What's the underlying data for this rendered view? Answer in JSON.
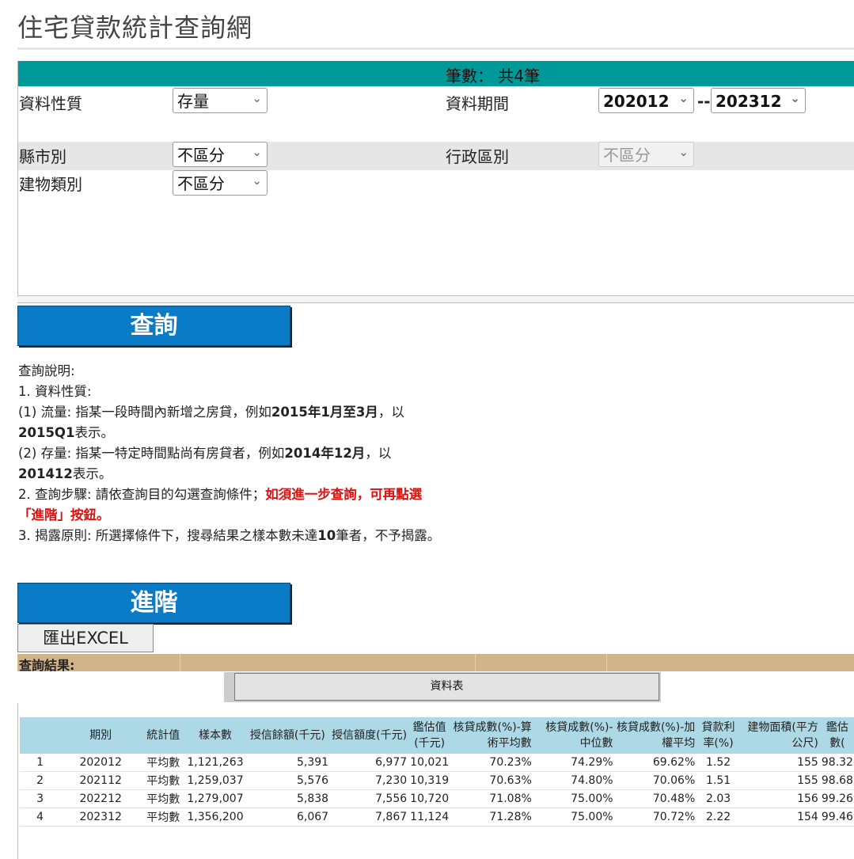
{
  "page_title": "住宅貸款統計查詢網",
  "record_count": "筆數： 共4筆",
  "filters": {
    "data_type_label": "資料性質",
    "data_type_value": "存量",
    "period_label": "資料期間",
    "period_from": "202012",
    "period_to": "202312",
    "period_sep": "--",
    "county_label": "縣市別",
    "county_value": "不區分",
    "district_label": "行政區別",
    "district_value": "不區分",
    "building_label": "建物類別",
    "building_value": "不區分"
  },
  "buttons": {
    "query": "查詢",
    "advanced": "進階",
    "export": "匯出EXCEL",
    "data_table": "資料表"
  },
  "help": {
    "heading": "查詢說明:",
    "item1": "1. 資料性質:",
    "flow_a": "(1) 流量: 指某一段時間內新增之房貸，例如",
    "flow_b": "2015年1月至3月",
    "flow_c": "，以",
    "flow_d": "2015Q1",
    "flow_e": "表示。",
    "stock_a": "(2) 存量: 指某一特定時間點尚有房貸者，例如",
    "stock_b": "2014年12月",
    "stock_c": "，以",
    "stock_d": "201412",
    "stock_e": "表示。",
    "item2a": "2. 查詢步驟: 請依查詢目的勾選查詢條件；",
    "item2b": "如須進一步查詢，可再點選「進階」按鈕。",
    "item3a": "3. 揭露原則: 所選擇條件下，搜尋結果之樣本數未達",
    "item3b": "10",
    "item3c": "筆者，不予揭露。"
  },
  "results_label": "查詢結果:",
  "table": {
    "headers": [
      "",
      "期別",
      "統計值",
      "樣本數",
      "授信餘額(千元)",
      "授信額度(千元)",
      "鑑估值(千元)",
      "核貸成數(%)-算術平均數",
      "核貸成數(%)-中位數",
      "核貸成數(%)-加權平均",
      "貸款利率(%)",
      "建物面積(平方公尺)",
      "鑑估數("
    ],
    "rows": [
      [
        "1",
        "202012",
        "平均數",
        "1,121,263",
        "5,391",
        "6,977",
        "10,021",
        "70.23%",
        "74.29%",
        "69.62%",
        "1.52",
        "155",
        "98.32"
      ],
      [
        "2",
        "202112",
        "平均數",
        "1,259,037",
        "5,576",
        "7,230",
        "10,319",
        "70.63%",
        "74.80%",
        "70.06%",
        "1.51",
        "155",
        "98.68"
      ],
      [
        "3",
        "202212",
        "平均數",
        "1,279,007",
        "5,838",
        "7,556",
        "10,720",
        "71.08%",
        "75.00%",
        "70.48%",
        "2.03",
        "156",
        "99.26"
      ],
      [
        "4",
        "202312",
        "平均數",
        "1,356,200",
        "6,067",
        "7,867",
        "11,124",
        "71.28%",
        "75.00%",
        "70.72%",
        "2.22",
        "154",
        "99.46"
      ]
    ]
  }
}
